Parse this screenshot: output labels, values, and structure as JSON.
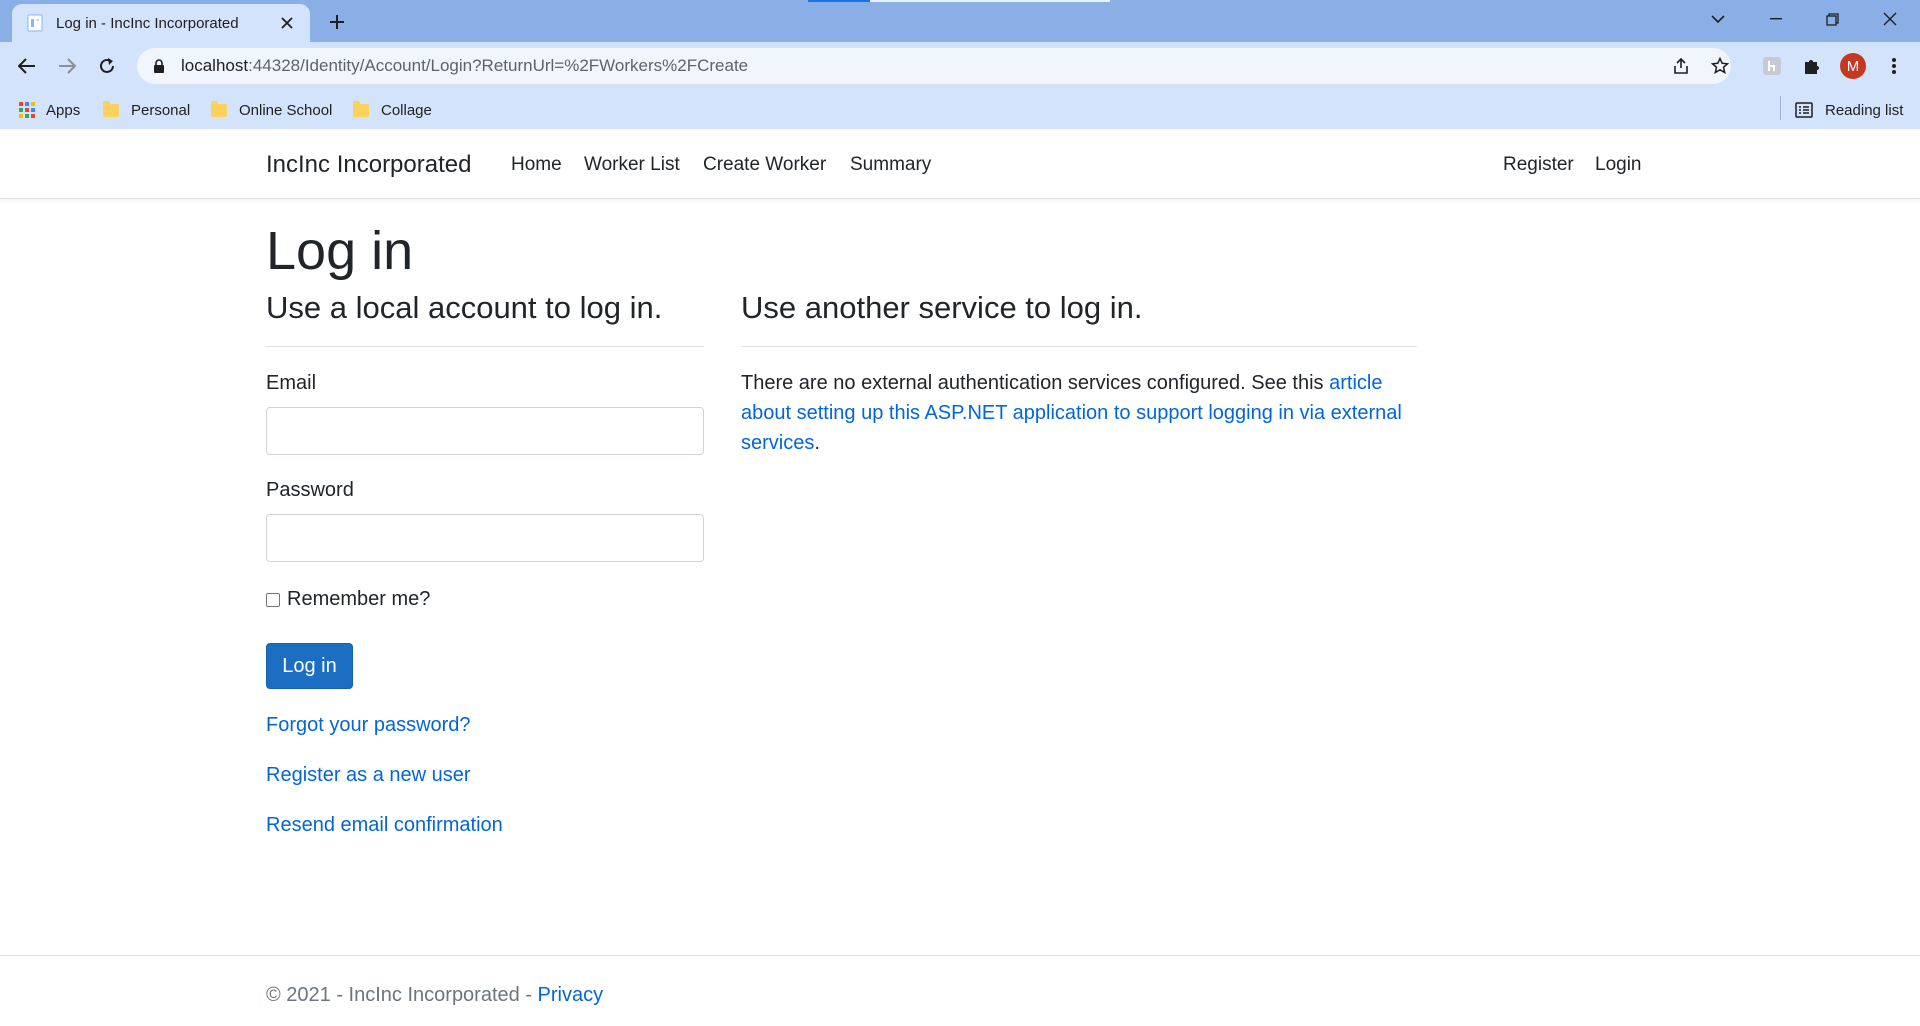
{
  "browser": {
    "tab_title": "Log in - IncInc Incorporated",
    "url_host": "localhost",
    "url_rest": ":44328/Identity/Account/Login?ReturnUrl=%2FWorkers%2FCreate",
    "avatar_letter": "M",
    "bookmarks": [
      "Apps",
      "Personal",
      "Online School",
      "Collage"
    ],
    "reading_list": "Reading list"
  },
  "nav": {
    "brand": "IncInc Incorporated",
    "links": [
      "Home",
      "Worker List",
      "Create Worker",
      "Summary"
    ],
    "register": "Register",
    "login": "Login"
  },
  "page": {
    "title": "Log in",
    "local_heading": "Use a local account to log in.",
    "email_label": "Email",
    "email_value": "",
    "password_label": "Password",
    "password_value": "",
    "remember_label": "Remember me?",
    "login_button": "Log in",
    "forgot_link": "Forgot your password?",
    "register_link": "Register as a new user",
    "resend_link": "Resend email confirmation",
    "external_heading": "Use another service to log in.",
    "external_text_before": "There are no external authentication services configured. See this ",
    "external_link": "article about setting up this ASP.NET application to support logging in via external services",
    "external_text_after": "."
  },
  "footer": {
    "text": "© 2021 - IncInc Incorporated - ",
    "privacy": "Privacy"
  },
  "colors": {
    "accent": "#1b6ec2",
    "link": "#0366d6",
    "chrome_tabstrip": "#8aaee6",
    "chrome_toolbar": "#d3e3fb"
  }
}
